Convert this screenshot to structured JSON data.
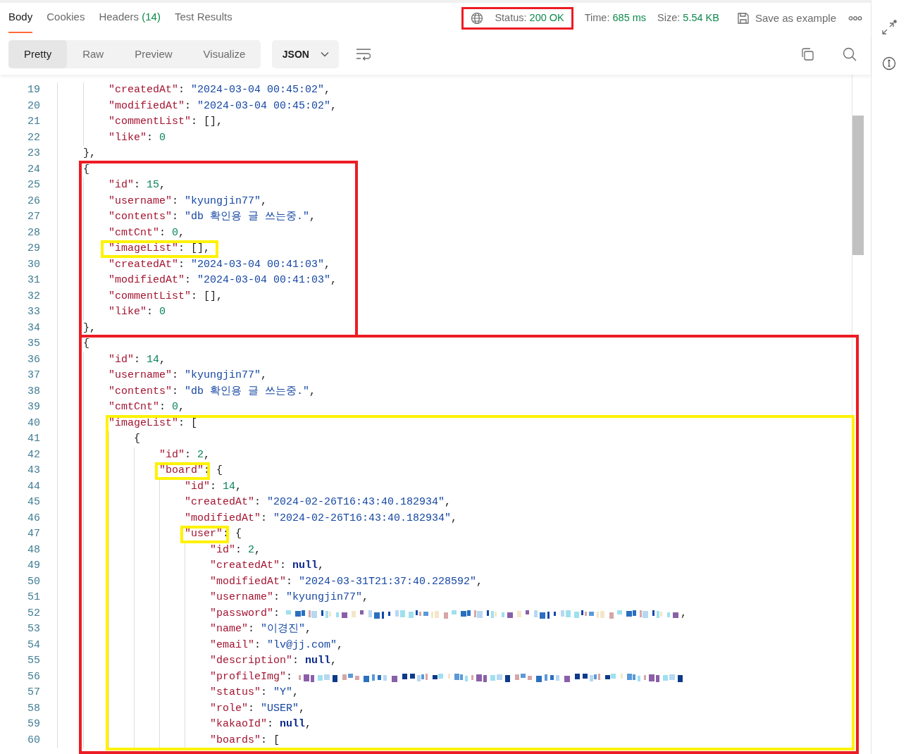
{
  "response_tabs": [
    {
      "label": "Body",
      "selected": true
    },
    {
      "label": "Cookies",
      "selected": false
    },
    {
      "label": "Headers",
      "count": "(14)",
      "selected": false
    },
    {
      "label": "Test Results",
      "selected": false
    }
  ],
  "status": {
    "label": "Status:",
    "value": "200 OK",
    "highlight": {
      "color": "#ed1c24"
    }
  },
  "time": {
    "label": "Time:",
    "value": "685 ms"
  },
  "size": {
    "label": "Size:",
    "value": "5.54 KB"
  },
  "save_button": "Save as example",
  "view_modes": [
    {
      "label": "Pretty",
      "selected": true
    },
    {
      "label": "Raw",
      "selected": false
    },
    {
      "label": "Preview",
      "selected": false
    },
    {
      "label": "Visualize",
      "selected": false
    }
  ],
  "format": "JSON",
  "lines": [
    {
      "children": [
        {
          "children": [
            {
              "no": "19",
              "tokens": [
                {
                  "kind": "key",
                  "text": "\"createdAt\""
                },
                {
                  "kind": "punct",
                  "text": ": "
                },
                {
                  "kind": "string",
                  "text": "\"2024-03-04 00:45:02\""
                },
                {
                  "kind": "punct",
                  "text": ","
                }
              ]
            },
            {
              "no": "20",
              "tokens": [
                {
                  "kind": "key",
                  "text": "\"modifiedAt\""
                },
                {
                  "kind": "punct",
                  "text": ": "
                },
                {
                  "kind": "string",
                  "text": "\"2024-03-04 00:45:02\""
                },
                {
                  "kind": "punct",
                  "text": ","
                }
              ]
            },
            {
              "no": "21",
              "tokens": [
                {
                  "kind": "key",
                  "text": "\"commentList\""
                },
                {
                  "kind": "punct",
                  "text": ": [],"
                }
              ]
            },
            {
              "no": "22",
              "tokens": [
                {
                  "kind": "key",
                  "text": "\"like\""
                },
                {
                  "kind": "punct",
                  "text": ": "
                },
                {
                  "kind": "number",
                  "text": "0"
                }
              ]
            }
          ]
        },
        {
          "no": "23",
          "tokens": [
            {
              "kind": "punct",
              "text": "},"
            }
          ]
        },
        {
          "no": "24",
          "frame": {
            "kind": "block",
            "color": "#ed1c24"
          },
          "tokens": [
            {
              "kind": "punct",
              "text": "{"
            }
          ],
          "children": [
            {
              "no": "25",
              "tokens": [
                {
                  "kind": "key",
                  "text": "\"id\""
                },
                {
                  "kind": "punct",
                  "text": ": "
                },
                {
                  "kind": "number",
                  "text": "15"
                },
                {
                  "kind": "punct",
                  "text": ","
                }
              ]
            },
            {
              "no": "26",
              "tokens": [
                {
                  "kind": "key",
                  "text": "\"username\""
                },
                {
                  "kind": "punct",
                  "text": ": "
                },
                {
                  "kind": "string",
                  "text": "\"kyungjin77\""
                },
                {
                  "kind": "punct",
                  "text": ","
                }
              ]
            },
            {
              "no": "27",
              "tokens": [
                {
                  "kind": "key",
                  "text": "\"contents\""
                },
                {
                  "kind": "punct",
                  "text": ": "
                },
                {
                  "kind": "string",
                  "text": "\"db 확인용 글 쓰는중.\""
                },
                {
                  "kind": "punct",
                  "text": ","
                }
              ]
            },
            {
              "no": "28",
              "tokens": [
                {
                  "kind": "key",
                  "text": "\"cmtCnt\""
                },
                {
                  "kind": "punct",
                  "text": ": "
                },
                {
                  "kind": "number",
                  "text": "0"
                },
                {
                  "kind": "punct",
                  "text": ","
                }
              ]
            },
            {
              "no": "29",
              "frame": {
                "kind": "line",
                "color": "#fff200"
              },
              "tokens": [
                {
                  "kind": "key",
                  "text": "\"imageList\""
                },
                {
                  "kind": "punct",
                  "text": ": [],"
                }
              ]
            },
            {
              "no": "30",
              "tokens": [
                {
                  "kind": "key",
                  "text": "\"createdAt\""
                },
                {
                  "kind": "punct",
                  "text": ": "
                },
                {
                  "kind": "string",
                  "text": "\"2024-03-04 00:41:03\""
                },
                {
                  "kind": "punct",
                  "text": ","
                }
              ]
            },
            {
              "no": "31",
              "tokens": [
                {
                  "kind": "key",
                  "text": "\"modifiedAt\""
                },
                {
                  "kind": "punct",
                  "text": ": "
                },
                {
                  "kind": "string",
                  "text": "\"2024-03-04 00:41:03\""
                },
                {
                  "kind": "punct",
                  "text": ","
                }
              ]
            },
            {
              "no": "32",
              "tokens": [
                {
                  "kind": "key",
                  "text": "\"commentList\""
                },
                {
                  "kind": "punct",
                  "text": ": [],"
                }
              ]
            },
            {
              "no": "33",
              "tokens": [
                {
                  "kind": "key",
                  "text": "\"like\""
                },
                {
                  "kind": "punct",
                  "text": ": "
                },
                {
                  "kind": "number",
                  "text": "0"
                }
              ]
            }
          ]
        },
        {
          "no": "34",
          "tokens": [
            {
              "kind": "punct",
              "text": "},"
            }
          ]
        },
        {
          "no": "35",
          "frame": {
            "kind": "subtree",
            "color": "#ed1c24",
            "continues": true
          },
          "tokens": [
            {
              "kind": "punct",
              "text": "{"
            }
          ],
          "children": [
            {
              "no": "36",
              "tokens": [
                {
                  "kind": "key",
                  "text": "\"id\""
                },
                {
                  "kind": "punct",
                  "text": ": "
                },
                {
                  "kind": "number",
                  "text": "14"
                },
                {
                  "kind": "punct",
                  "text": ","
                }
              ]
            },
            {
              "no": "37",
              "tokens": [
                {
                  "kind": "key",
                  "text": "\"username\""
                },
                {
                  "kind": "punct",
                  "text": ": "
                },
                {
                  "kind": "string",
                  "text": "\"kyungjin77\""
                },
                {
                  "kind": "punct",
                  "text": ","
                }
              ]
            },
            {
              "no": "38",
              "tokens": [
                {
                  "kind": "key",
                  "text": "\"contents\""
                },
                {
                  "kind": "punct",
                  "text": ": "
                },
                {
                  "kind": "string",
                  "text": "\"db 확인용 글 쓰는중.\""
                },
                {
                  "kind": "punct",
                  "text": ","
                }
              ]
            },
            {
              "no": "39",
              "tokens": [
                {
                  "kind": "key",
                  "text": "\"cmtCnt\""
                },
                {
                  "kind": "punct",
                  "text": ": "
                },
                {
                  "kind": "number",
                  "text": "0"
                },
                {
                  "kind": "punct",
                  "text": ","
                }
              ]
            },
            {
              "no": "40",
              "frame": {
                "kind": "subtree",
                "color": "#fff200"
              },
              "tokens": [
                {
                  "kind": "key",
                  "text": "\"imageList\""
                },
                {
                  "kind": "punct",
                  "text": ": ["
                }
              ],
              "children": [
                {
                  "no": "41",
                  "tokens": [
                    {
                      "kind": "punct",
                      "text": "{"
                    }
                  ],
                  "children": [
                    {
                      "no": "42",
                      "tokens": [
                        {
                          "kind": "key",
                          "text": "\"id\""
                        },
                        {
                          "kind": "punct",
                          "text": ": "
                        },
                        {
                          "kind": "number",
                          "text": "2"
                        },
                        {
                          "kind": "punct",
                          "text": ","
                        }
                      ]
                    },
                    {
                      "no": "43",
                      "frame": {
                        "kind": "key",
                        "color": "#fff200"
                      },
                      "tokens": [
                        {
                          "kind": "key",
                          "text": "\"board\""
                        },
                        {
                          "kind": "punct",
                          "text": ": {"
                        }
                      ],
                      "children": [
                        {
                          "no": "44",
                          "tokens": [
                            {
                              "kind": "key",
                              "text": "\"id\""
                            },
                            {
                              "kind": "punct",
                              "text": ": "
                            },
                            {
                              "kind": "number",
                              "text": "14"
                            },
                            {
                              "kind": "punct",
                              "text": ","
                            }
                          ]
                        },
                        {
                          "no": "45",
                          "tokens": [
                            {
                              "kind": "key",
                              "text": "\"createdAt\""
                            },
                            {
                              "kind": "punct",
                              "text": ": "
                            },
                            {
                              "kind": "string",
                              "text": "\"2024-02-26T16:43:40.182934\""
                            },
                            {
                              "kind": "punct",
                              "text": ","
                            }
                          ]
                        },
                        {
                          "no": "46",
                          "tokens": [
                            {
                              "kind": "key",
                              "text": "\"modifiedAt\""
                            },
                            {
                              "kind": "punct",
                              "text": ": "
                            },
                            {
                              "kind": "string",
                              "text": "\"2024-02-26T16:43:40.182934\""
                            },
                            {
                              "kind": "punct",
                              "text": ","
                            }
                          ]
                        },
                        {
                          "no": "47",
                          "frame": {
                            "kind": "key",
                            "color": "#fff200"
                          },
                          "tokens": [
                            {
                              "kind": "key",
                              "text": "\"user\""
                            },
                            {
                              "kind": "punct",
                              "text": ": {"
                            }
                          ],
                          "children": [
                            {
                              "no": "48",
                              "tokens": [
                                {
                                  "kind": "key",
                                  "text": "\"id\""
                                },
                                {
                                  "kind": "punct",
                                  "text": ": "
                                },
                                {
                                  "kind": "number",
                                  "text": "2"
                                },
                                {
                                  "kind": "punct",
                                  "text": ","
                                }
                              ]
                            },
                            {
                              "no": "49",
                              "tokens": [
                                {
                                  "kind": "key",
                                  "text": "\"createdAt\""
                                },
                                {
                                  "kind": "punct",
                                  "text": ": "
                                },
                                {
                                  "kind": "null",
                                  "text": "null"
                                },
                                {
                                  "kind": "punct",
                                  "text": ","
                                }
                              ]
                            },
                            {
                              "no": "50",
                              "tokens": [
                                {
                                  "kind": "key",
                                  "text": "\"modifiedAt\""
                                },
                                {
                                  "kind": "punct",
                                  "text": ": "
                                },
                                {
                                  "kind": "string",
                                  "text": "\"2024-03-31T21:37:40.228592\""
                                },
                                {
                                  "kind": "punct",
                                  "text": ","
                                }
                              ]
                            },
                            {
                              "no": "51",
                              "tokens": [
                                {
                                  "kind": "key",
                                  "text": "\"username\""
                                },
                                {
                                  "kind": "punct",
                                  "text": ": "
                                },
                                {
                                  "kind": "string",
                                  "text": "\"kyungjin77\""
                                },
                                {
                                  "kind": "punct",
                                  "text": ","
                                }
                              ]
                            },
                            {
                              "no": "52",
                              "tokens": [
                                {
                                  "kind": "key",
                                  "text": "\"password\""
                                },
                                {
                                  "kind": "punct",
                                  "text": ": "
                                },
                                {
                                  "kind": "redacted"
                                },
                                {
                                  "kind": "punct",
                                  "text": ","
                                }
                              ]
                            },
                            {
                              "no": "53",
                              "tokens": [
                                {
                                  "kind": "key",
                                  "text": "\"name\""
                                },
                                {
                                  "kind": "punct",
                                  "text": ": "
                                },
                                {
                                  "kind": "string",
                                  "text": "\"이경진\""
                                },
                                {
                                  "kind": "punct",
                                  "text": ","
                                }
                              ]
                            },
                            {
                              "no": "54",
                              "tokens": [
                                {
                                  "kind": "key",
                                  "text": "\"email\""
                                },
                                {
                                  "kind": "punct",
                                  "text": ": "
                                },
                                {
                                  "kind": "string",
                                  "text": "\"lv@jj.com\""
                                },
                                {
                                  "kind": "punct",
                                  "text": ","
                                }
                              ]
                            },
                            {
                              "no": "55",
                              "tokens": [
                                {
                                  "kind": "key",
                                  "text": "\"description\""
                                },
                                {
                                  "kind": "punct",
                                  "text": ": "
                                },
                                {
                                  "kind": "null",
                                  "text": "null"
                                },
                                {
                                  "kind": "punct",
                                  "text": ","
                                }
                              ]
                            },
                            {
                              "no": "56",
                              "tokens": [
                                {
                                  "kind": "key",
                                  "text": "\"profileImg\""
                                },
                                {
                                  "kind": "punct",
                                  "text": ": "
                                },
                                {
                                  "kind": "redacted"
                                }
                              ]
                            },
                            {
                              "no": "57",
                              "tokens": [
                                {
                                  "kind": "key",
                                  "text": "\"status\""
                                },
                                {
                                  "kind": "punct",
                                  "text": ": "
                                },
                                {
                                  "kind": "string",
                                  "text": "\"Y\""
                                },
                                {
                                  "kind": "punct",
                                  "text": ","
                                }
                              ]
                            },
                            {
                              "no": "58",
                              "tokens": [
                                {
                                  "kind": "key",
                                  "text": "\"role\""
                                },
                                {
                                  "kind": "punct",
                                  "text": ": "
                                },
                                {
                                  "kind": "string",
                                  "text": "\"USER\""
                                },
                                {
                                  "kind": "punct",
                                  "text": ","
                                }
                              ]
                            },
                            {
                              "no": "59",
                              "tokens": [
                                {
                                  "kind": "key",
                                  "text": "\"kakaoId\""
                                },
                                {
                                  "kind": "punct",
                                  "text": ": "
                                },
                                {
                                  "kind": "null",
                                  "text": "null"
                                },
                                {
                                  "kind": "punct",
                                  "text": ","
                                }
                              ]
                            },
                            {
                              "no": "60",
                              "tokens": [
                                {
                                  "kind": "key",
                                  "text": "\"boards\""
                                },
                                {
                                  "kind": "punct",
                                  "text": ": ["
                                }
                              ]
                            }
                          ]
                        }
                      ]
                    }
                  ]
                }
              ]
            }
          ]
        }
      ]
    }
  ]
}
